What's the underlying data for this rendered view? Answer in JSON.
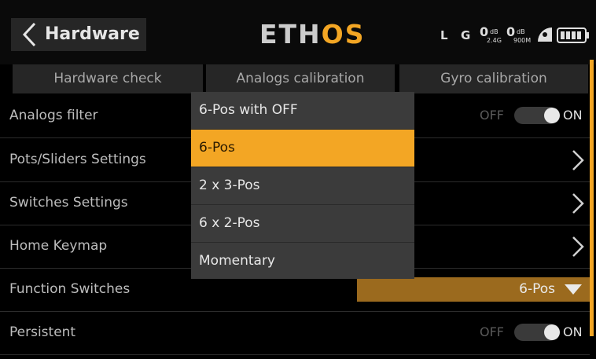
{
  "header": {
    "title": "Hardware",
    "logo_left": "ETH",
    "logo_right": "OS",
    "status": {
      "l_label": "L",
      "g_label": "G",
      "val1": "0",
      "unit1": "dB",
      "sub1": "2.4G",
      "val2": "0",
      "unit2": "dB",
      "sub2": "900M"
    }
  },
  "tabs": [
    "Hardware check",
    "Analogs calibration",
    "Gyro calibration"
  ],
  "rows": {
    "analogs_filter": {
      "label": "Analogs filter",
      "off": "OFF",
      "on": "ON"
    },
    "pots_sliders": {
      "label": "Pots/Sliders Settings"
    },
    "switches": {
      "label": "Switches Settings"
    },
    "home_keymap": {
      "label": "Home Keymap"
    },
    "function_switches": {
      "label": "Function Switches",
      "value": "6-Pos"
    },
    "persistent": {
      "label": "Persistent",
      "off": "OFF",
      "on": "ON"
    }
  },
  "dropdown": {
    "options": [
      "6-Pos with OFF",
      "6-Pos",
      "2 x 3-Pos",
      "6 x 2-Pos",
      "Momentary"
    ],
    "selected": "6-Pos"
  },
  "colors": {
    "accent": "#f3a624",
    "select_bg": "#9b6a1e",
    "dropdown_bg": "#3b3b3b"
  },
  "icons": [
    "back-chevron-icon",
    "radio-link-icon",
    "gps-icon",
    "signal-icon",
    "battery-icon",
    "chevron-right-icon",
    "dropdown-triangle-icon"
  ]
}
